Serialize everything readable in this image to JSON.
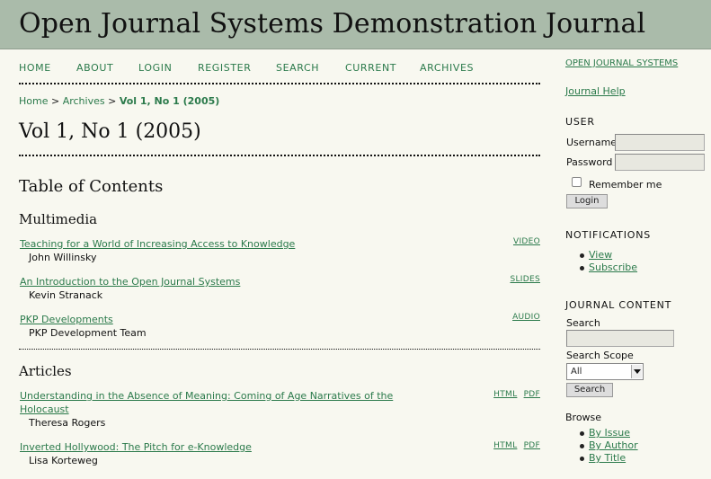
{
  "journal_title": "Open Journal Systems Demonstration Journal",
  "nav": [
    "Home",
    "About",
    "Login",
    "Register",
    "Search",
    "Current",
    "Archives"
  ],
  "breadcrumb": {
    "home": "Home",
    "sep1": ">",
    "archives": "Archives",
    "sep2": ">",
    "current": "Vol 1, No 1 (2005)"
  },
  "issue_title": "Vol 1, No 1 (2005)",
  "toc_title": "Table of Contents",
  "sections": [
    {
      "title": "Multimedia",
      "articles": [
        {
          "title": "Teaching for a World of Increasing Access to Knowledge",
          "author": "John Willinsky",
          "galleys": [
            "VIDEO"
          ]
        },
        {
          "title": "An Introduction to the Open Journal Systems",
          "author": "Kevin Stranack",
          "galleys": [
            "SLIDES"
          ]
        },
        {
          "title": "PKP Developments",
          "author": "PKP Development Team",
          "galleys": [
            "AUDIO"
          ]
        }
      ]
    },
    {
      "title": "Articles",
      "articles": [
        {
          "title": "Understanding in the Absence of Meaning: Coming of Age Narratives of the Holocaust",
          "author": "Theresa Rogers",
          "galleys": [
            "HTML",
            "PDF"
          ]
        },
        {
          "title": "Inverted Hollywood: The Pitch for e-Knowledge",
          "author": "Lisa Korteweg",
          "galleys": [
            "HTML",
            "PDF"
          ]
        }
      ]
    }
  ],
  "sidebar": {
    "ojs_link": "OPEN JOURNAL SYSTEMS",
    "help_link": "Journal Help",
    "user": {
      "heading": "User",
      "username_label": "Username",
      "password_label": "Password",
      "remember_label": "Remember me",
      "login_button": "Login"
    },
    "notifications": {
      "heading": "Notifications",
      "items": [
        "View",
        "Subscribe"
      ]
    },
    "journal_content": {
      "heading": "Journal Content",
      "search_label": "Search",
      "scope_label": "Search Scope",
      "scope_value": "All",
      "search_button": "Search",
      "browse_label": "Browse",
      "browse_items": [
        "By Issue",
        "By Author",
        "By Title"
      ]
    }
  }
}
